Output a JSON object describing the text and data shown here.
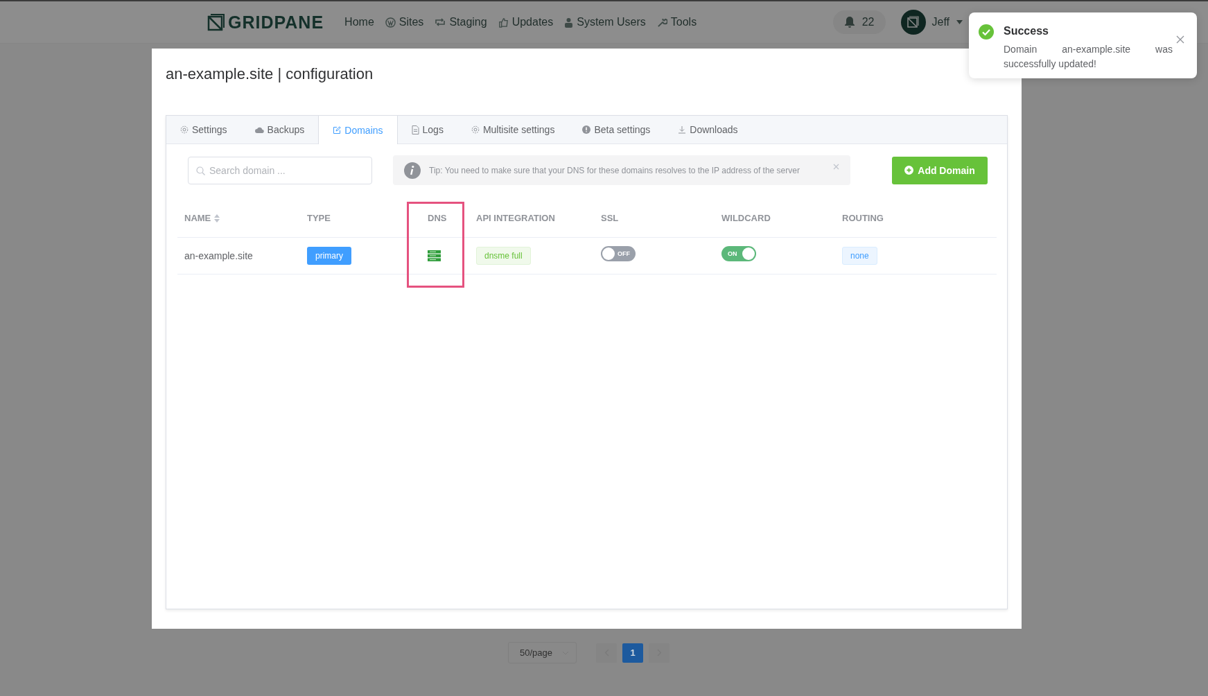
{
  "nav": {
    "logo": "GRIDPANE",
    "items": [
      {
        "label": "Home",
        "kind": "plain"
      },
      {
        "label": "Sites",
        "kind": "wp"
      },
      {
        "label": "Staging",
        "kind": "sync"
      },
      {
        "label": "Updates",
        "kind": "thumb"
      },
      {
        "label": "System Users",
        "kind": "users"
      },
      {
        "label": "Tools",
        "kind": "wrench"
      }
    ],
    "notifications": "22",
    "user": "Jeff"
  },
  "toast": {
    "title": "Success",
    "message": "Domain an-example.site was successfully updated!"
  },
  "dialog": {
    "title": "an-example.site | configuration",
    "tabs": [
      {
        "label": "Settings",
        "kind": "gear",
        "selected": false
      },
      {
        "label": "Backups",
        "kind": "cloud",
        "selected": false
      },
      {
        "label": "Domains",
        "kind": "edit",
        "selected": true
      },
      {
        "label": "Logs",
        "kind": "doc",
        "selected": false
      },
      {
        "label": "Multisite settings",
        "kind": "gear",
        "selected": false
      },
      {
        "label": "Beta settings",
        "kind": "alert",
        "selected": false
      },
      {
        "label": "Downloads",
        "kind": "download",
        "selected": false
      }
    ],
    "search": {
      "placeholder": "Search domain ..."
    },
    "tip": "Tip: You need to make sure that your DNS for these domains resolves to the IP address of the server",
    "add_button": "Add Domain",
    "table": {
      "columns": [
        {
          "label": "NAME",
          "sortable": true,
          "highlighted": false
        },
        {
          "label": "TYPE",
          "sortable": false,
          "highlighted": false
        },
        {
          "label": "DNS",
          "sortable": false,
          "highlighted": true
        },
        {
          "label": "API INTEGRATION",
          "sortable": false,
          "highlighted": false
        },
        {
          "label": "SSL",
          "sortable": false,
          "highlighted": false
        },
        {
          "label": "WILDCARD",
          "sortable": false,
          "highlighted": false
        },
        {
          "label": "ROUTING",
          "sortable": false,
          "highlighted": false
        }
      ],
      "rows": [
        {
          "name": "an-example.site",
          "type": "primary",
          "api": "dnsme full",
          "ssl": {
            "on": false,
            "label": "OFF"
          },
          "wildcard": {
            "on": true,
            "label": "ON"
          },
          "routing": "none"
        }
      ]
    }
  },
  "pagination": {
    "page_size": "50/page",
    "pages": [
      {
        "label": "1",
        "selected": true
      }
    ]
  }
}
